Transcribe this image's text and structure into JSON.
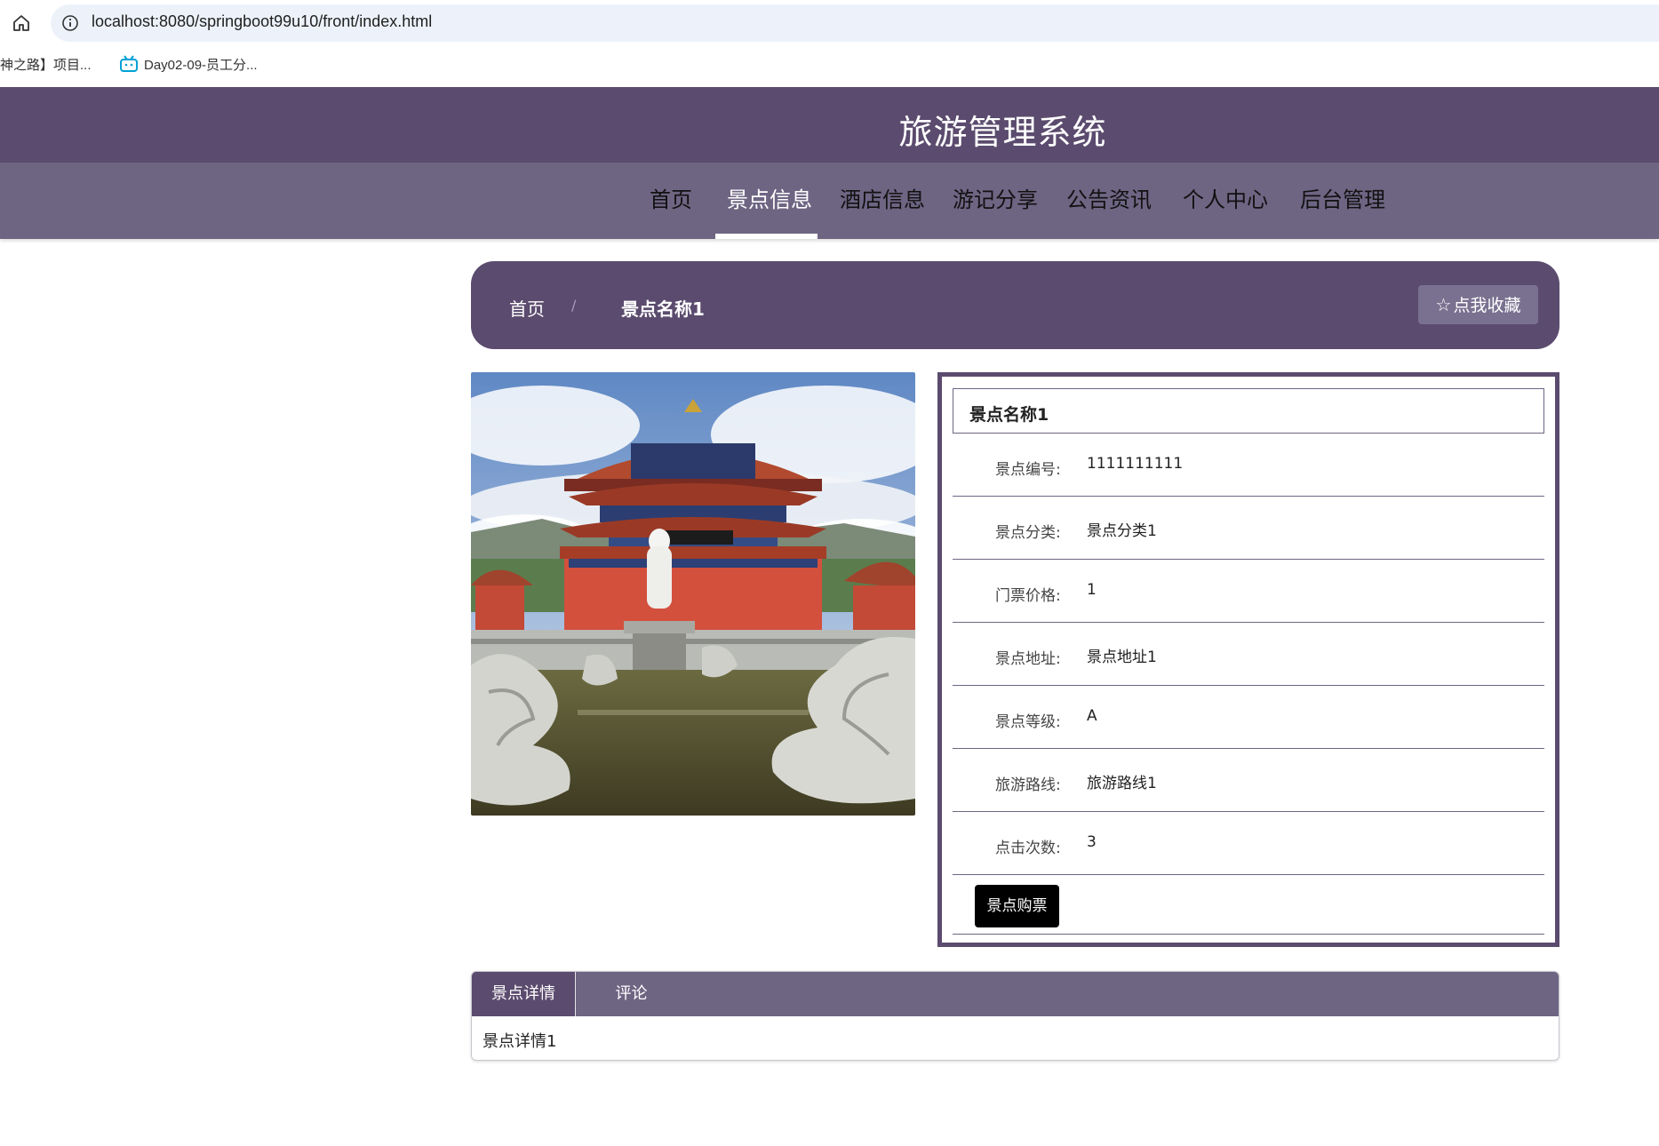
{
  "browser": {
    "url": "localhost:8080/springboot99u10/front/index.html",
    "bookmarks": [
      "神之路】项目...",
      "Day02-09-员工分..."
    ]
  },
  "site": {
    "title": "旅游管理系统",
    "nav": [
      "首页",
      "景点信息",
      "酒店信息",
      "游记分享",
      "公告资讯",
      "个人中心",
      "后台管理"
    ],
    "active_nav": "景点信息"
  },
  "breadcrumb": {
    "home": "首页",
    "separator": "/",
    "current": "景点名称1",
    "favorite_button": "点我收藏"
  },
  "scene": {
    "image_icon": "temple-photo",
    "name": "景点名称1",
    "fields": [
      {
        "label": "景点编号:",
        "value": "1111111111"
      },
      {
        "label": "景点分类:",
        "value": "景点分类1"
      },
      {
        "label": "门票价格:",
        "value": "1"
      },
      {
        "label": "景点地址:",
        "value": "景点地址1"
      },
      {
        "label": "景点等级:",
        "value": "A"
      },
      {
        "label": "旅游路线:",
        "value": "旅游路线1"
      },
      {
        "label": "点击次数:",
        "value": "3"
      }
    ],
    "buy_button": "景点购票"
  },
  "tabs": {
    "items": [
      "景点详情",
      "评论"
    ],
    "active": "景点详情",
    "content": "景点详情1"
  },
  "colors": {
    "header": "#5b4b6e",
    "nav": "#6e6583"
  }
}
